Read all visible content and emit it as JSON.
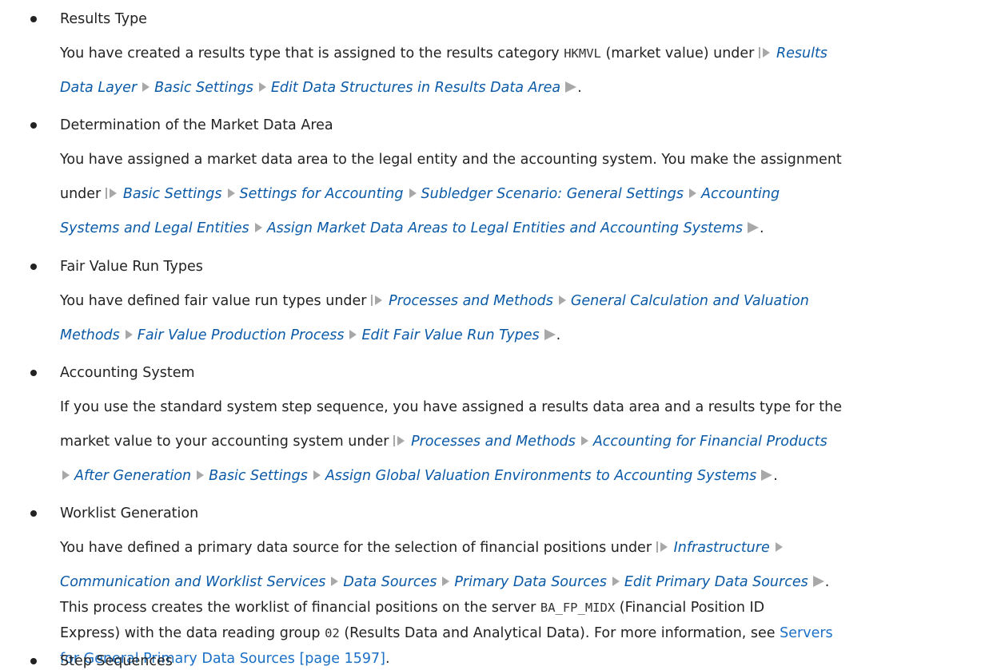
{
  "colors": {
    "text": "#222222",
    "path": "#0a5aa8",
    "link": "#1a6fc7",
    "icon": "#a8a8a8"
  },
  "icons": {
    "path_start": "menu-path-start-icon",
    "path_separator": "menu-path-separator-icon",
    "path_end": "menu-path-end-icon"
  },
  "items": [
    {
      "title": "Results Type",
      "l1": {
        "a": "You have created a results type that is assigned to the results category ",
        "code": "HKMVL",
        "b": " (market value) under ",
        "p1": "Results"
      },
      "l2": {
        "p1": "Data Layer",
        "p2": "Basic Settings",
        "p3": "Edit Data Structures in Results Data Area",
        "end": "."
      }
    },
    {
      "title": "Determination of the Market Data Area",
      "l1": "You have assigned a market data area to the legal entity and the accounting system. You make the assignment",
      "l2": {
        "a": "under ",
        "p1": "Basic Settings",
        "p2": "Settings for Accounting",
        "p3": "Subledger Scenario: General Settings",
        "p4": "Accounting"
      },
      "l3": {
        "p1": "Systems and Legal Entities",
        "p2": "Assign Market Data Areas to Legal Entities and Accounting Systems",
        "end": "."
      }
    },
    {
      "title": "Fair Value Run Types",
      "l1": {
        "a": "You have defined fair value run types under ",
        "p1": "Processes and Methods",
        "p2": "General Calculation and Valuation"
      },
      "l2": {
        "p1": "Methods",
        "p2": "Fair Value Production Process",
        "p3": "Edit Fair Value Run Types",
        "end": "."
      }
    },
    {
      "title": "Accounting System",
      "l1": "If you use the standard system step sequence, you have assigned a results data area and a results type for the",
      "l2": {
        "a": "market value to your accounting system under ",
        "p1": "Processes and Methods",
        "p2": "Accounting for Financial Products"
      },
      "l3": {
        "p1": "After Generation",
        "p2": "Basic Settings",
        "p3": "Assign Global Valuation Environments to Accounting Systems",
        "end": "."
      }
    },
    {
      "title": "Worklist Generation",
      "l1": {
        "a": "You have defined a primary data source for the selection of financial positions under ",
        "p1": "Infrastructure"
      },
      "l2": {
        "p1": "Communication and Worklist Services",
        "p2": "Data Sources",
        "p3": "Primary Data Sources",
        "p4": "Edit Primary Data Sources",
        "end": "."
      },
      "l3": {
        "a": "This process creates the worklist of financial positions on the server ",
        "code": "BA_FP_MIDX",
        "b": " (Financial Position ID"
      },
      "l4": {
        "a": "Express) with the data reading group ",
        "code": "02",
        "b": " (Results Data and Analytical Data). For more information, see ",
        "link": "Servers"
      },
      "l5": {
        "link": "for General Primary Data Sources [page 1597]",
        "end": "."
      }
    },
    {
      "title": "Step Sequences"
    }
  ]
}
